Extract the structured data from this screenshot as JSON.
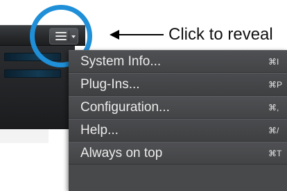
{
  "annotation": {
    "text": "Click to reveal"
  },
  "menu_button": {
    "icon": "hamburger-menu-icon",
    "dropdown_icon": "chevron-down-icon"
  },
  "menu": {
    "items": [
      {
        "label": "System Info...",
        "shortcut": "⌘I"
      },
      {
        "label": "Plug-Ins...",
        "shortcut": "⌘P"
      },
      {
        "label": "Configuration...",
        "shortcut": "⌘,"
      },
      {
        "label": "Help...",
        "shortcut": "⌘/"
      },
      {
        "label": "Always on top",
        "shortcut": "⌘T"
      }
    ]
  },
  "colors": {
    "highlight_ring": "#1f8fd8",
    "menu_bg": "#48494b",
    "toolbar_bg": "#26282a"
  }
}
